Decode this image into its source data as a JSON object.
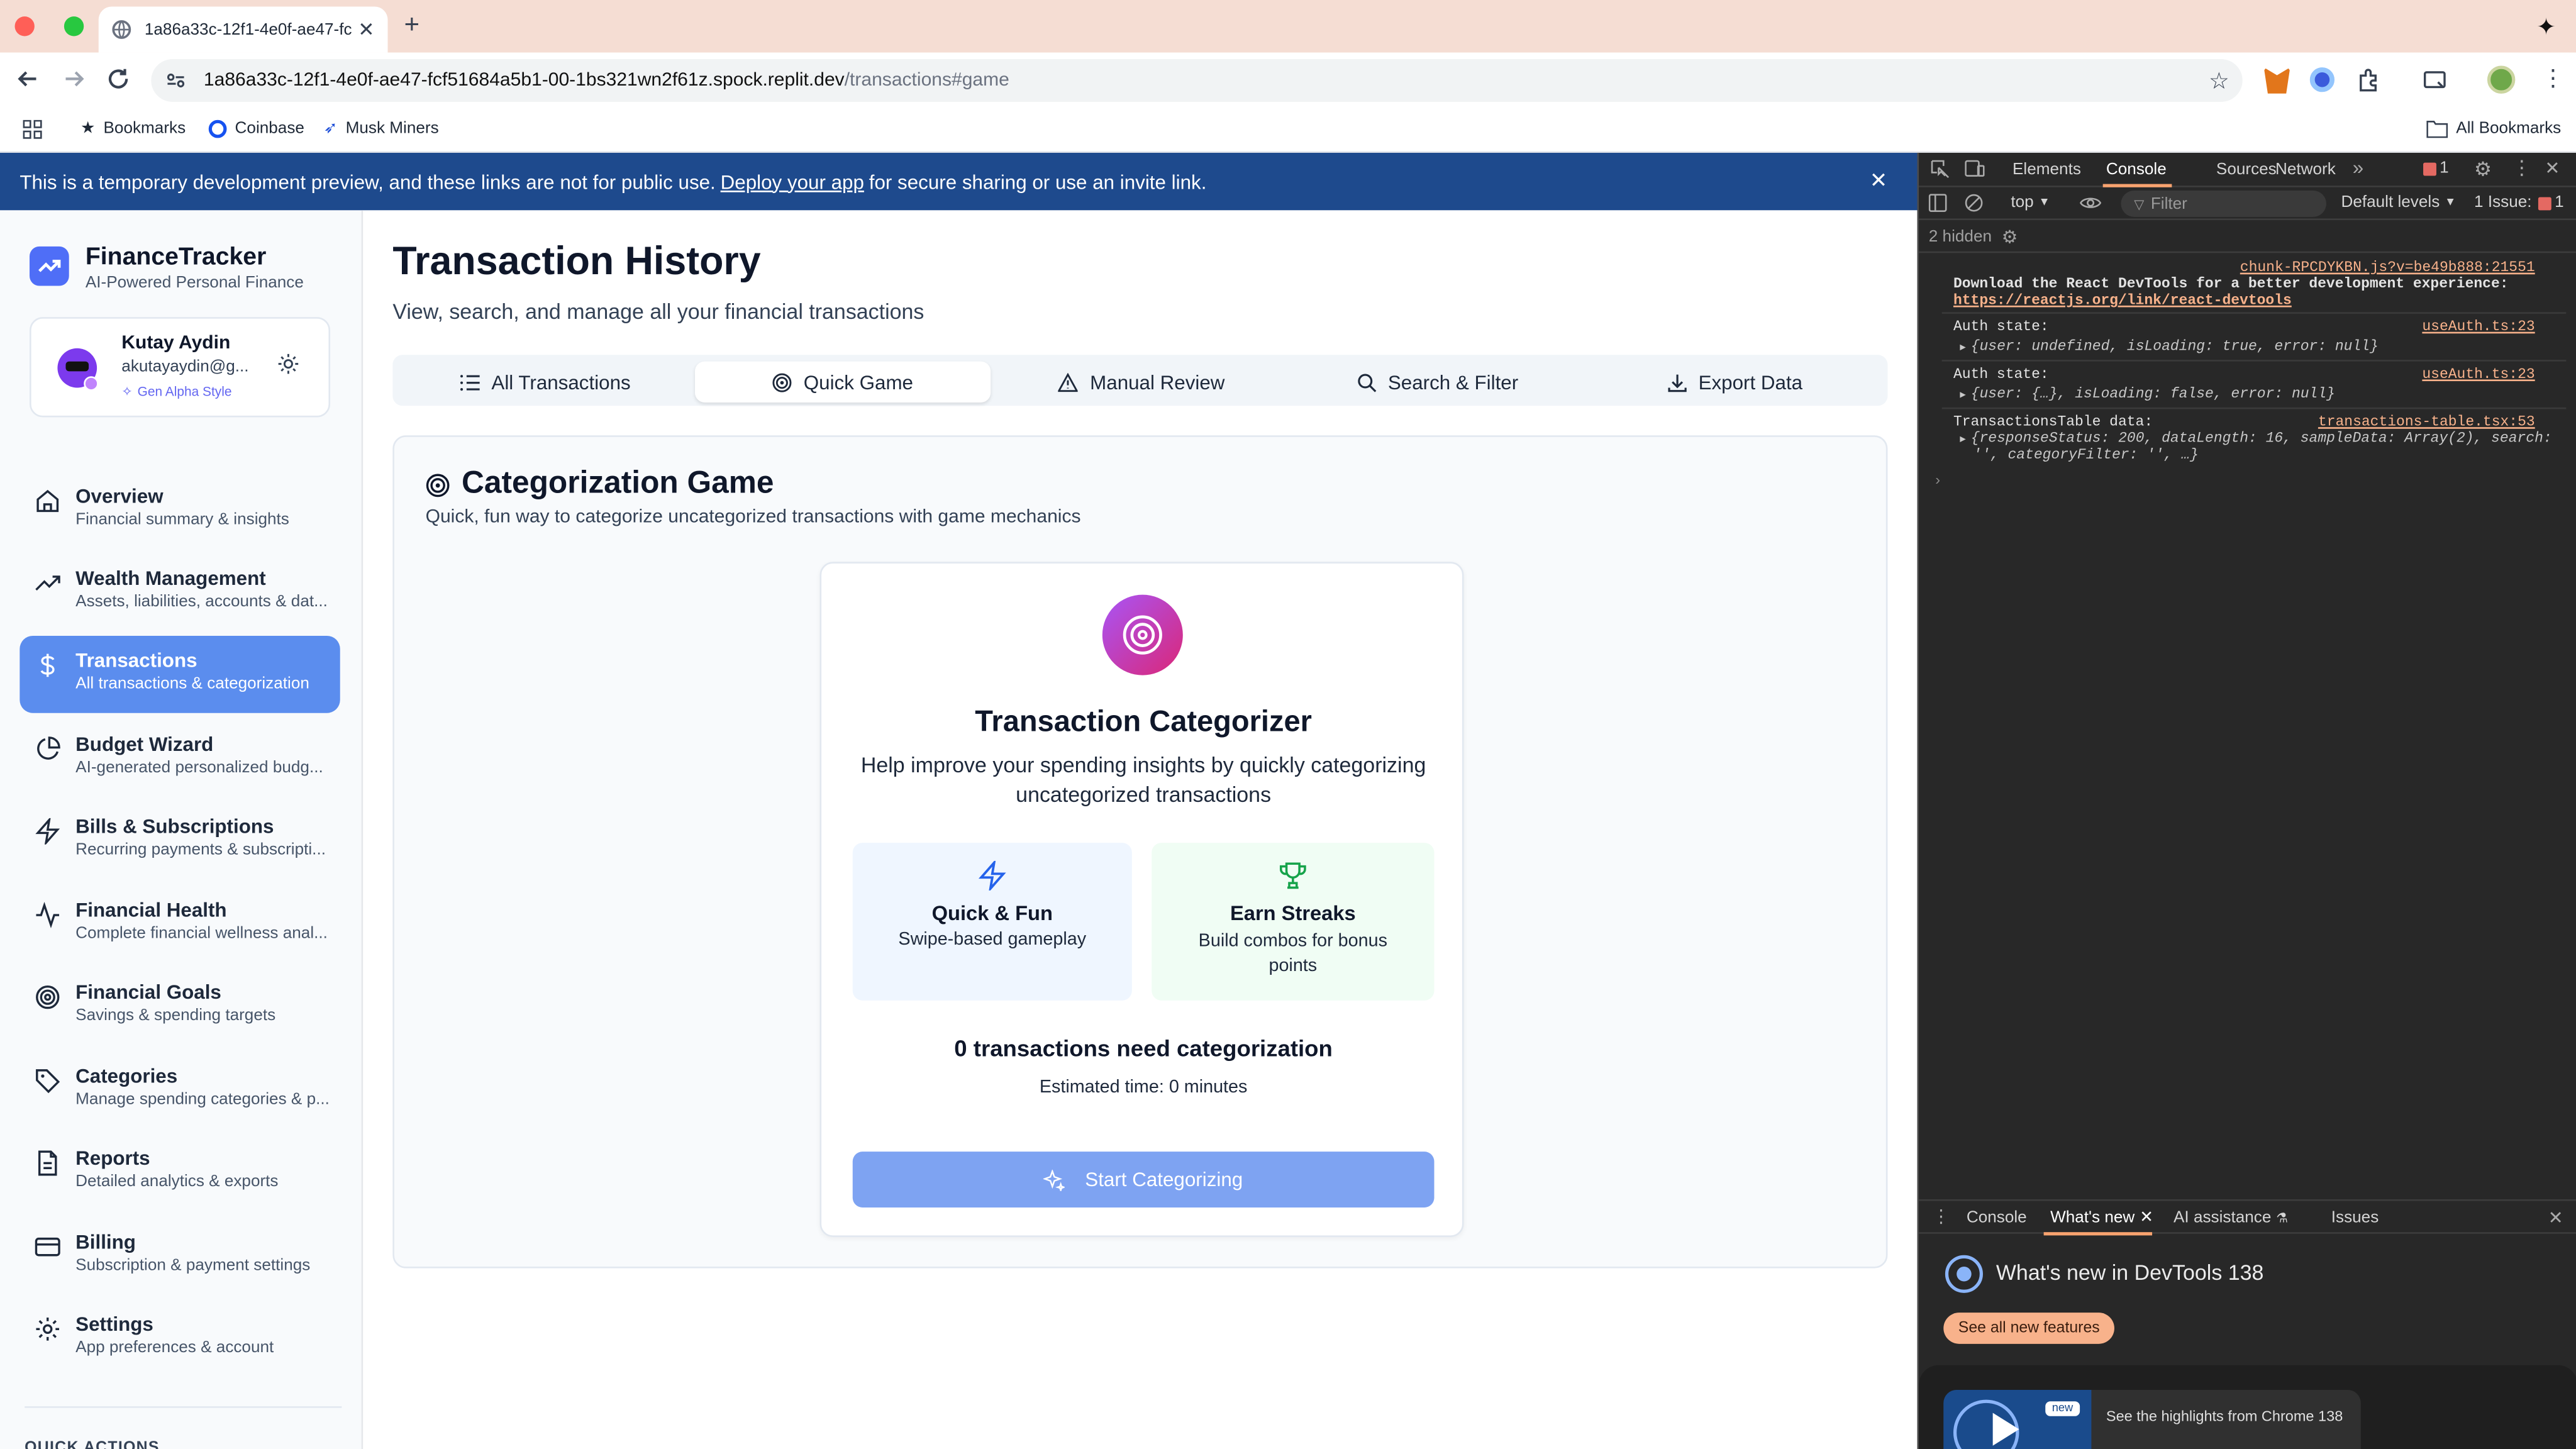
{
  "browser": {
    "tab_title": "1a86a33c-12f1-4e0f-ae47-fc",
    "url_host": "1a86a33c-12f1-4e0f-ae47-fcf51684a5b1-00-1bs321wn2f61z.spock.replit.dev",
    "url_path": "/transactions#game",
    "bookmarks": [
      "Bookmarks",
      "Coinbase",
      "Musk Miners"
    ],
    "all_bookmarks": "All Bookmarks"
  },
  "banner": {
    "text_before": "This is a temporary development preview, and these links are not for public use.",
    "link": "Deploy your app",
    "text_after": "for secure sharing or use an invite link."
  },
  "sidebar": {
    "app_name": "FinanceTracker",
    "app_tagline": "AI-Powered Personal Finance",
    "user": {
      "name": "Kutay Aydin",
      "email": "akutayaydin@g...",
      "style": "Gen Alpha Style"
    },
    "items": [
      {
        "label": "Overview",
        "desc": "Financial summary & insights",
        "icon": "home-icon"
      },
      {
        "label": "Wealth Management",
        "desc": "Assets, liabilities, accounts & dat...",
        "icon": "trending-up-icon"
      },
      {
        "label": "Transactions",
        "desc": "All transactions & categorization",
        "icon": "dollar-icon"
      },
      {
        "label": "Budget Wizard",
        "desc": "AI-generated personalized budg...",
        "icon": "pie-chart-icon"
      },
      {
        "label": "Bills & Subscriptions",
        "desc": "Recurring payments & subscripti...",
        "icon": "zap-icon"
      },
      {
        "label": "Financial Health",
        "desc": "Complete financial wellness anal...",
        "icon": "activity-icon"
      },
      {
        "label": "Financial Goals",
        "desc": "Savings & spending targets",
        "icon": "target-icon"
      },
      {
        "label": "Categories",
        "desc": "Manage spending categories & p...",
        "icon": "tag-icon"
      },
      {
        "label": "Reports",
        "desc": "Detailed analytics & exports",
        "icon": "file-text-icon"
      },
      {
        "label": "Billing",
        "desc": "Subscription & payment settings",
        "icon": "credit-card-icon"
      },
      {
        "label": "Settings",
        "desc": "App preferences & account",
        "icon": "gear-icon"
      }
    ],
    "quick_actions": "QUICK ACTIONS"
  },
  "main": {
    "title": "Transaction History",
    "subtitle": "View, search, and manage all your financial transactions",
    "tabs": [
      "All Transactions",
      "Quick Game",
      "Manual Review",
      "Search & Filter",
      "Export Data"
    ],
    "card_title": "Categorization Game",
    "card_subtitle": "Quick, fun way to categorize uncategorized transactions with game mechanics",
    "game": {
      "title": "Transaction Categorizer",
      "description": "Help improve your spending insights by quickly categorizing uncategorized transactions",
      "feature1_title": "Quick & Fun",
      "feature1_desc": "Swipe-based gameplay",
      "feature2_title": "Earn Streaks",
      "feature2_desc": "Build combos for bonus points",
      "count_text": "0 transactions need categorization",
      "estimate": "Estimated time: 0 minutes",
      "start_button": "Start Categorizing"
    }
  },
  "devtools": {
    "tabs": [
      "Elements",
      "Console",
      "Sources",
      "Network"
    ],
    "error_count": "1",
    "context": "top",
    "filter_placeholder": "Filter",
    "levels": "Default levels",
    "issues_label": "1 Issue:",
    "issues_count": "1",
    "hidden": "2 hidden",
    "logs": [
      {
        "source": "chunk-RPCDYKBN.js?v=be49b888:21551",
        "line1": "Download the React DevTools for a better development experience:",
        "link": "https://reactjs.org/link/react-devtools"
      },
      {
        "source": "useAuth.ts:23",
        "label": "Auth state:",
        "detail": "{user: undefined, isLoading: true, error: null}"
      },
      {
        "source": "useAuth.ts:23",
        "label": "Auth state:",
        "detail": "{user: {…}, isLoading: false, error: null}"
      },
      {
        "source": "transactions-table.tsx:53",
        "label": "TransactionsTable data:",
        "detail1": "{responseStatus: 200, dataLength: 16, sampleData: Array(2), search:",
        "detail2": "'', categoryFilter: '', …}"
      }
    ],
    "drawer_tabs": [
      "Console",
      "What's new",
      "AI assistance",
      "Issues"
    ],
    "whats_new_title": "What's new in DevTools 138",
    "see_all": "See all new features",
    "highlight_badge": "new",
    "highlight_text": "See the highlights from Chrome 138"
  }
}
